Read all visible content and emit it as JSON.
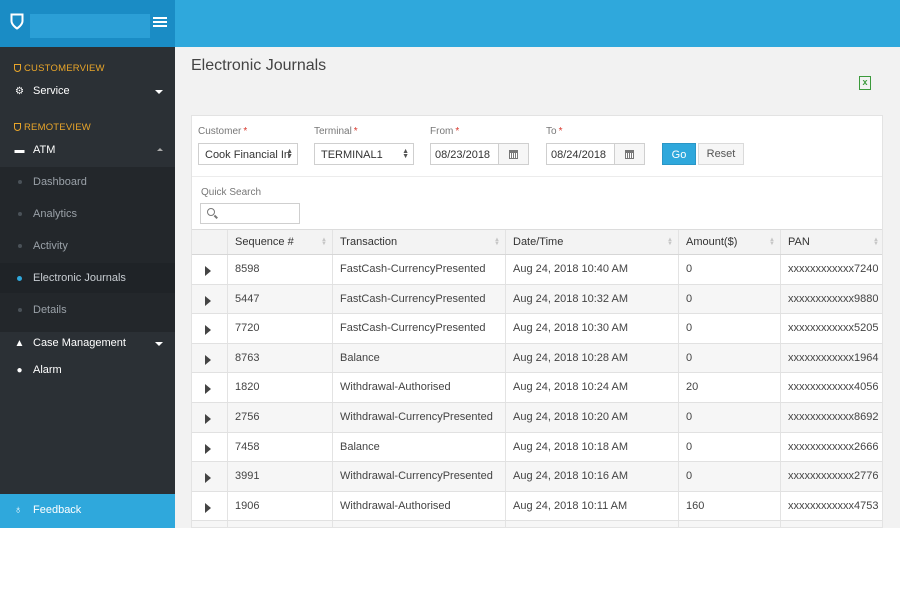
{
  "app": {
    "title": "Electronic Journals"
  },
  "sidebar": {
    "sections": [
      {
        "label": "CUSTOMERVIEW"
      },
      {
        "label": "REMOTEVIEW"
      }
    ],
    "service": {
      "label": "Service",
      "icon": "gears-icon"
    },
    "atm": {
      "label": "ATM",
      "icon": "atm-icon",
      "items": [
        {
          "label": "Dashboard"
        },
        {
          "label": "Analytics"
        },
        {
          "label": "Activity"
        },
        {
          "label": "Electronic Journals",
          "active": true
        },
        {
          "label": "Details"
        }
      ]
    },
    "case_management": {
      "label": "Case Management",
      "icon": "graduation-cap-icon"
    },
    "alarm": {
      "label": "Alarm",
      "icon": "bell-icon"
    },
    "feedback": {
      "label": "Feedback",
      "icon": "lightbulb-icon"
    }
  },
  "filters": {
    "customer": {
      "label": "Customer",
      "value": "Cook Financial In"
    },
    "terminal": {
      "label": "Terminal",
      "value": "TERMINAL1"
    },
    "from": {
      "label": "From",
      "value": "08/23/2018"
    },
    "to": {
      "label": "To",
      "value": "08/24/2018"
    },
    "required_mark": "*",
    "go_label": "Go",
    "reset_label": "Reset"
  },
  "quick_search": {
    "label": "Quick Search",
    "placeholder": ""
  },
  "table": {
    "columns": [
      "Sequence #",
      "Transaction",
      "Date/Time",
      "Amount($)",
      "PAN"
    ],
    "rows": [
      [
        "8598",
        "FastCash-CurrencyPresented",
        "Aug 24, 2018 10:40 AM",
        "0",
        "xxxxxxxxxxxx7240"
      ],
      [
        "5447",
        "FastCash-CurrencyPresented",
        "Aug 24, 2018 10:32 AM",
        "0",
        "xxxxxxxxxxxx9880"
      ],
      [
        "7720",
        "FastCash-CurrencyPresented",
        "Aug 24, 2018 10:30 AM",
        "0",
        "xxxxxxxxxxxx5205"
      ],
      [
        "8763",
        "Balance",
        "Aug 24, 2018 10:28 AM",
        "0",
        "xxxxxxxxxxxx1964"
      ],
      [
        "1820",
        "Withdrawal-Authorised",
        "Aug 24, 2018 10:24 AM",
        "20",
        "xxxxxxxxxxxx4056"
      ],
      [
        "2756",
        "Withdrawal-CurrencyPresented",
        "Aug 24, 2018 10:20 AM",
        "0",
        "xxxxxxxxxxxx8692"
      ],
      [
        "7458",
        "Balance",
        "Aug 24, 2018 10:18 AM",
        "0",
        "xxxxxxxxxxxx2666"
      ],
      [
        "3991",
        "Withdrawal-CurrencyPresented",
        "Aug 24, 2018 10:16 AM",
        "0",
        "xxxxxxxxxxxx2776"
      ],
      [
        "1906",
        "Withdrawal-Authorised",
        "Aug 24, 2018 10:11 AM",
        "160",
        "xxxxxxxxxxxx4753"
      ]
    ]
  },
  "colors": {
    "accent": "#2fa8dc",
    "brand_bar": "#1a8cc5",
    "sidebar_bg": "#2b3035",
    "section_label": "#e8a52a",
    "required": "#d9372c",
    "excel_green": "#3c9a3c"
  },
  "icons": {
    "logo": "shield-logo-icon",
    "menu": "hamburger-menu-icon",
    "export": "excel-export-icon",
    "search": "search-icon",
    "calendar": "calendar-icon",
    "expand_row": "caret-right-icon",
    "sort": "sort-icon"
  }
}
